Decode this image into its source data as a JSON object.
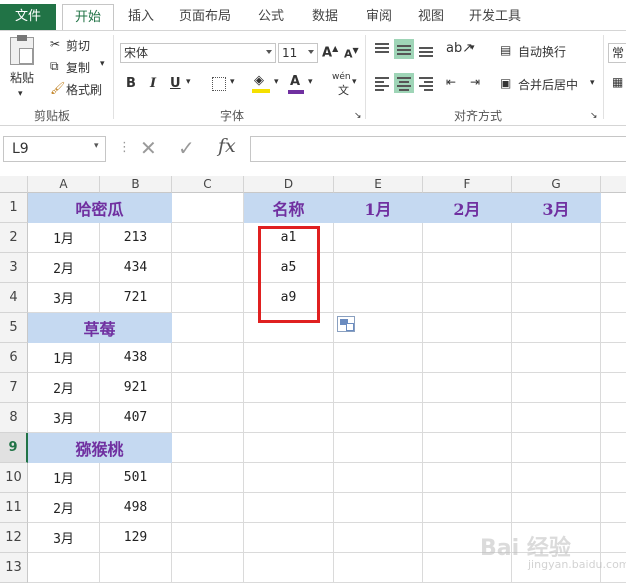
{
  "tabs": [
    {
      "label": "文件"
    },
    {
      "label": "开始"
    },
    {
      "label": "插入"
    },
    {
      "label": "页面布局"
    },
    {
      "label": "公式"
    },
    {
      "label": "数据"
    },
    {
      "label": "审阅"
    },
    {
      "label": "视图"
    },
    {
      "label": "开发工具"
    }
  ],
  "ribbon": {
    "clipboard": {
      "paste": "粘贴",
      "cut": "剪切",
      "copy": "复制",
      "format_painter": "格式刷",
      "group_label": "剪贴板"
    },
    "font": {
      "name": "宋体",
      "size": "11",
      "bold": "B",
      "italic": "I",
      "underline": "U",
      "phonetic": "wén",
      "group_label": "字体"
    },
    "alignment": {
      "wrap_text": "自动换行",
      "merge_center": "合并后居中",
      "group_label": "对齐方式"
    },
    "number": {
      "format": "常"
    }
  },
  "formula_bar": {
    "name_box": "L9",
    "cancel": "✕",
    "enter": "✓",
    "fx": "fx",
    "content": ""
  },
  "columns": [
    "A",
    "B",
    "C",
    "D",
    "E",
    "F",
    "G"
  ],
  "rows": [
    "1",
    "2",
    "3",
    "4",
    "5",
    "6",
    "7",
    "8",
    "9",
    "10",
    "11",
    "12",
    "13"
  ],
  "selected_row": "9",
  "cells": {
    "A1": "哈密瓜",
    "A2": "1月",
    "B2": "213",
    "A3": "2月",
    "B3": "434",
    "A4": "3月",
    "B4": "721",
    "A5": "草莓",
    "A6": "1月",
    "B6": "438",
    "A7": "2月",
    "B7": "921",
    "A8": "3月",
    "B8": "407",
    "A9": "猕猴桃",
    "A10": "1月",
    "B10": "501",
    "A11": "2月",
    "B11": "498",
    "A12": "3月",
    "B12": "129",
    "D1": "名称",
    "E1": "1月",
    "F1": "2月",
    "G1": "3月",
    "D2": "a1",
    "D3": "a5",
    "D4": "a9"
  },
  "colors": {
    "accent": "#217346",
    "header_fill": "#c5d9f1",
    "header_text": "#7030a0",
    "highlight_box": "#e02020"
  },
  "watermark": {
    "brand": "Bai 经验",
    "url": "jingyan.baidu.com"
  }
}
